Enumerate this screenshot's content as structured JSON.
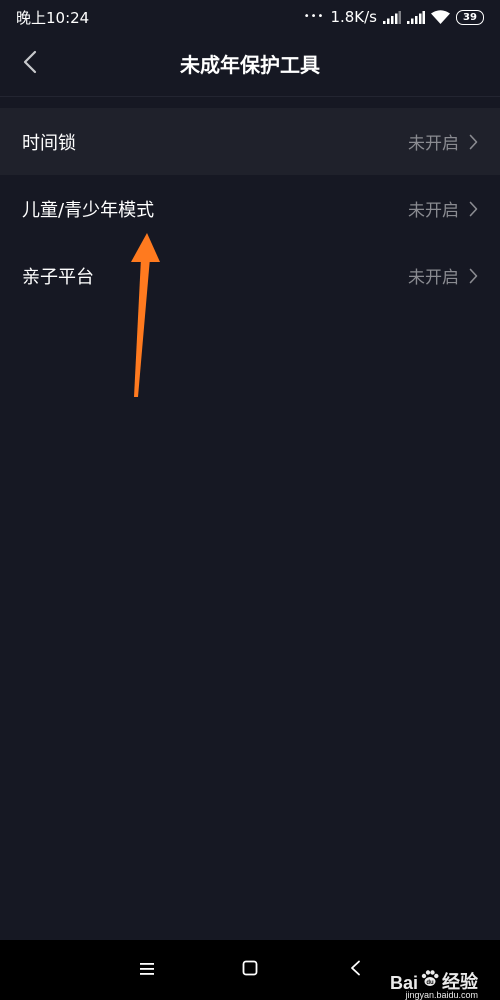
{
  "status_bar": {
    "time": "晚上10:24",
    "dots": "•••",
    "network_speed": "1.8K/s",
    "battery_level": "39",
    "icons": [
      "signal-icon",
      "signal-icon",
      "wifi-icon",
      "battery-icon"
    ]
  },
  "header": {
    "back_icon": "chevron-left-icon",
    "title": "未成年保护工具"
  },
  "menu": {
    "items": [
      {
        "label": "时间锁",
        "status": "未开启"
      },
      {
        "label": "儿童/青少年模式",
        "status": "未开启"
      },
      {
        "label": "亲子平台",
        "status": "未开启"
      }
    ]
  },
  "annotation": {
    "arrow_color": "#ff7a1f"
  },
  "nav_bar": {
    "icons": [
      "menu-icon",
      "home-square-icon",
      "back-triangle-icon"
    ]
  },
  "watermark": {
    "logo": "Bai",
    "logo_suffix": "du",
    "text": "经验",
    "url": "jingyan.baidu.com"
  },
  "colors": {
    "background": "#161823",
    "highlight_row": "#1f212b",
    "status_text": "#8a8b91",
    "arrow": "#ff7a1f"
  }
}
